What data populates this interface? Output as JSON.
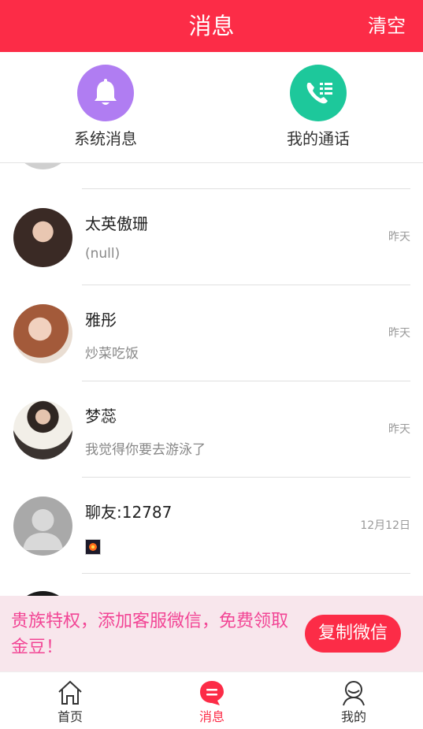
{
  "header": {
    "title": "消息",
    "clear_label": "清空"
  },
  "quick_entries": {
    "system": {
      "label": "系统消息",
      "icon": "bell-icon",
      "color": "#b07df2"
    },
    "calls": {
      "label": "我的通话",
      "icon": "phone-list-icon",
      "color": "#1dc89b"
    }
  },
  "conversations": [
    {
      "name": "太英傲珊",
      "preview": "(null)",
      "time": "昨天"
    },
    {
      "name": "雅彤",
      "preview": "炒菜吃饭",
      "time": "昨天"
    },
    {
      "name": "梦蕊",
      "preview": "我觉得你要去游泳了",
      "time": "昨天"
    },
    {
      "name": "聊友:12787",
      "preview": "",
      "time": "12月12日"
    }
  ],
  "promo": {
    "text": "贵族特权，添加客服微信，免费领取金豆！",
    "button_label": "复制微信"
  },
  "tabbar": {
    "home": {
      "label": "首页",
      "icon": "home-icon"
    },
    "messages": {
      "label": "消息",
      "icon": "chat-icon",
      "active": true
    },
    "me": {
      "label": "我的",
      "icon": "profile-icon"
    }
  },
  "colors": {
    "brand": "#fc2c47",
    "promo_text": "#f24595",
    "promo_bg": "#f8e6ec"
  }
}
